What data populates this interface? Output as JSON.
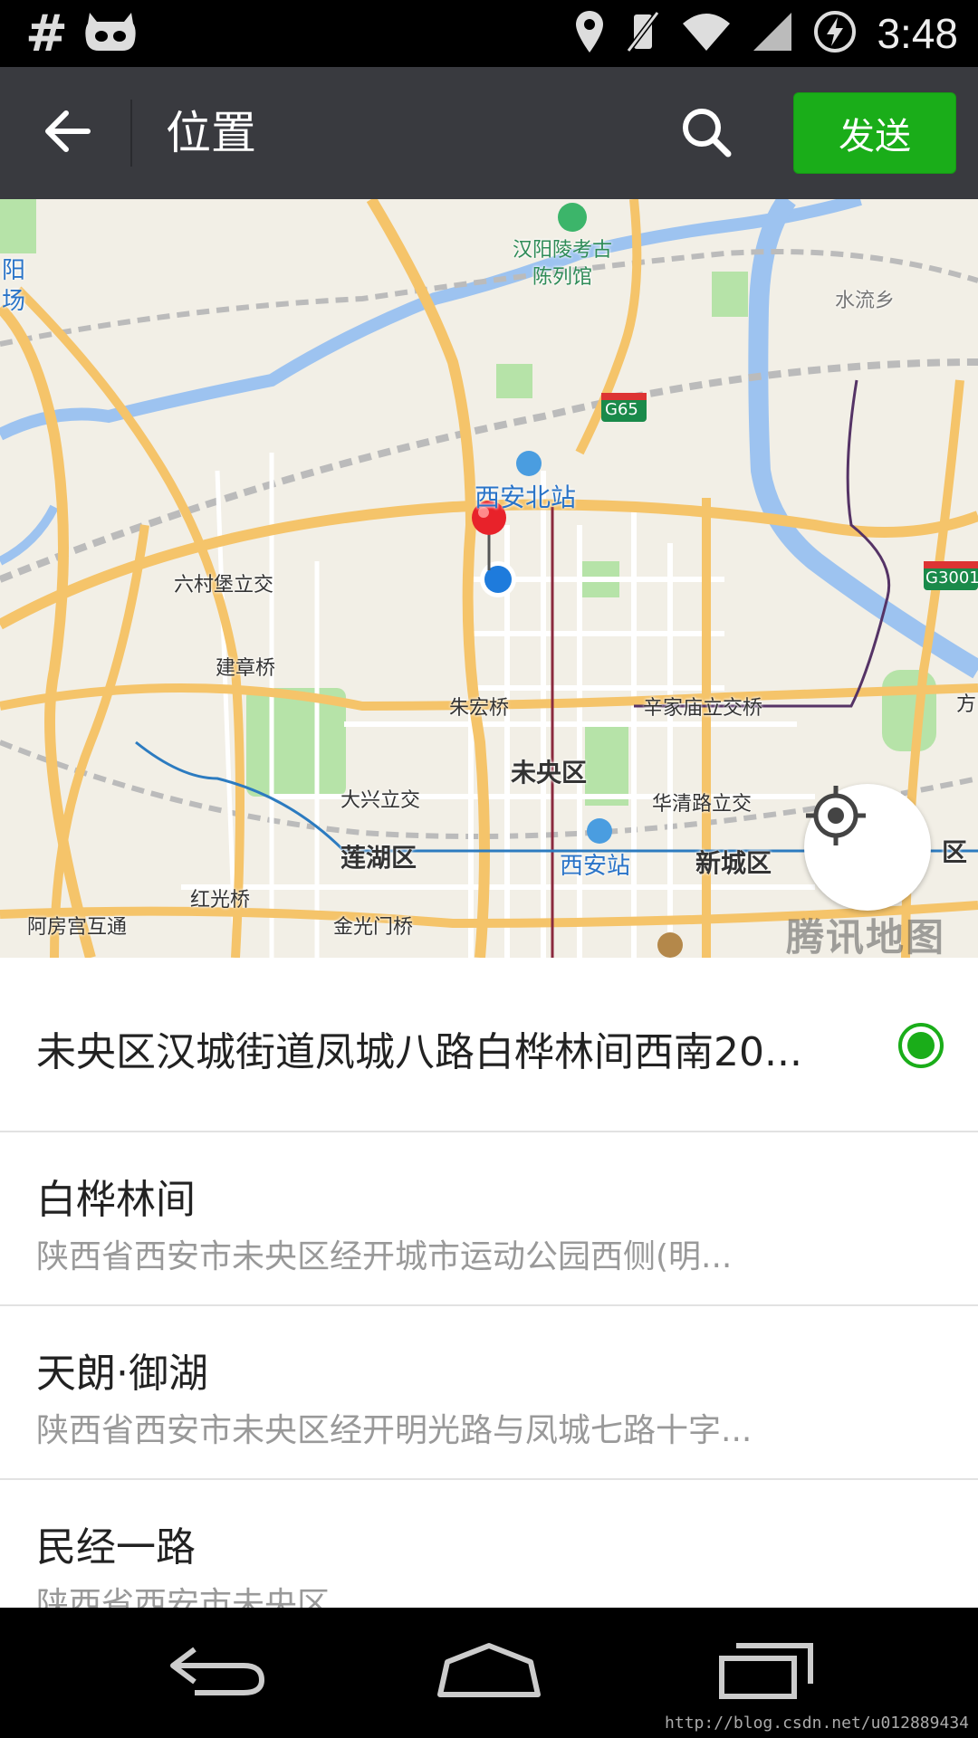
{
  "status_bar": {
    "left_icons": [
      "hash-icon",
      "cyanogenmod-mascot-icon"
    ],
    "right_icons": [
      "location-icon",
      "vibrate-mute-icon",
      "wifi-icon",
      "signal-icon",
      "battery-charging-icon"
    ],
    "hash_glyph": "#",
    "time": "3:48"
  },
  "toolbar": {
    "back_icon": "arrow-left-icon",
    "title": "位置",
    "search_icon": "search-icon",
    "send_label": "发送",
    "send_color": "#1aad19",
    "background": "#393a3f"
  },
  "map": {
    "labels": {
      "museum": "汉阳陵考古\n陈列馆",
      "shuiliu": "水流乡",
      "yang": "阳",
      "chang": "场",
      "g65": "G65",
      "g3001": "G3001",
      "xian_north": "西安北站",
      "liucunbao": "六村堡立交",
      "jianzhang": "建章桥",
      "zhuhong": "朱宏桥",
      "xinjiamiao": "辛家庙立交桥",
      "weiyang": "未央区",
      "daxing": "大兴立交",
      "huaqing": "华清路立交",
      "lianhu": "莲湖区",
      "xian_station": "西安站",
      "xincheng": "新城区",
      "hongguang": "红光桥",
      "afanggong": "阿房宫互通",
      "jinguang": "金光门桥",
      "fang": "方",
      "qu": "区"
    },
    "watermark": "腾讯地图",
    "locate_icon": "crosshair-locate-icon"
  },
  "list": {
    "items": [
      {
        "title": "未央区汉城街道凤城八路白桦林间西南20...",
        "selected": true
      },
      {
        "title": "白桦林间",
        "subtitle": "陕西省西安市未央区经开城市运动公园西侧(明..."
      },
      {
        "title": "天朗·御湖",
        "subtitle": "陕西省西安市未央区经开明光路与凤城七路十字..."
      },
      {
        "title": "民经一路",
        "subtitle": "陕西省西安市未央区"
      }
    ]
  },
  "navbar": {
    "back_icon": "nav-back-icon",
    "home_icon": "nav-home-icon",
    "recents_icon": "nav-recents-icon",
    "blog_url": "http://blog.csdn.net/u012889434"
  }
}
